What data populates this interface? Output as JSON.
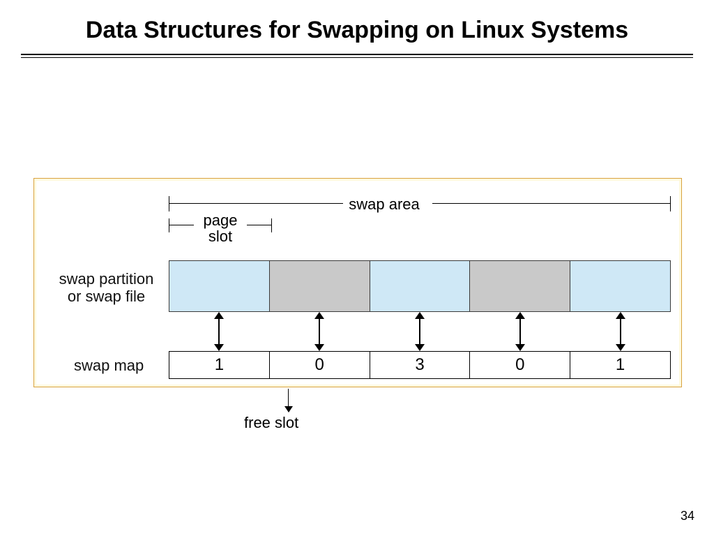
{
  "title": "Data Structures for Swapping on Linux Systems",
  "page_number": "34",
  "diagram": {
    "swap_area_label": "swap area",
    "page_slot_label": "page\nslot",
    "partition_label": "swap partition\nor swap file",
    "swap_map_label": "swap map",
    "free_slot_label": "free slot",
    "slot_colors": [
      "c-blue",
      "c-grey",
      "c-blue",
      "c-grey",
      "c-blue"
    ],
    "swap_map_values": [
      "1",
      "0",
      "3",
      "0",
      "1"
    ]
  }
}
